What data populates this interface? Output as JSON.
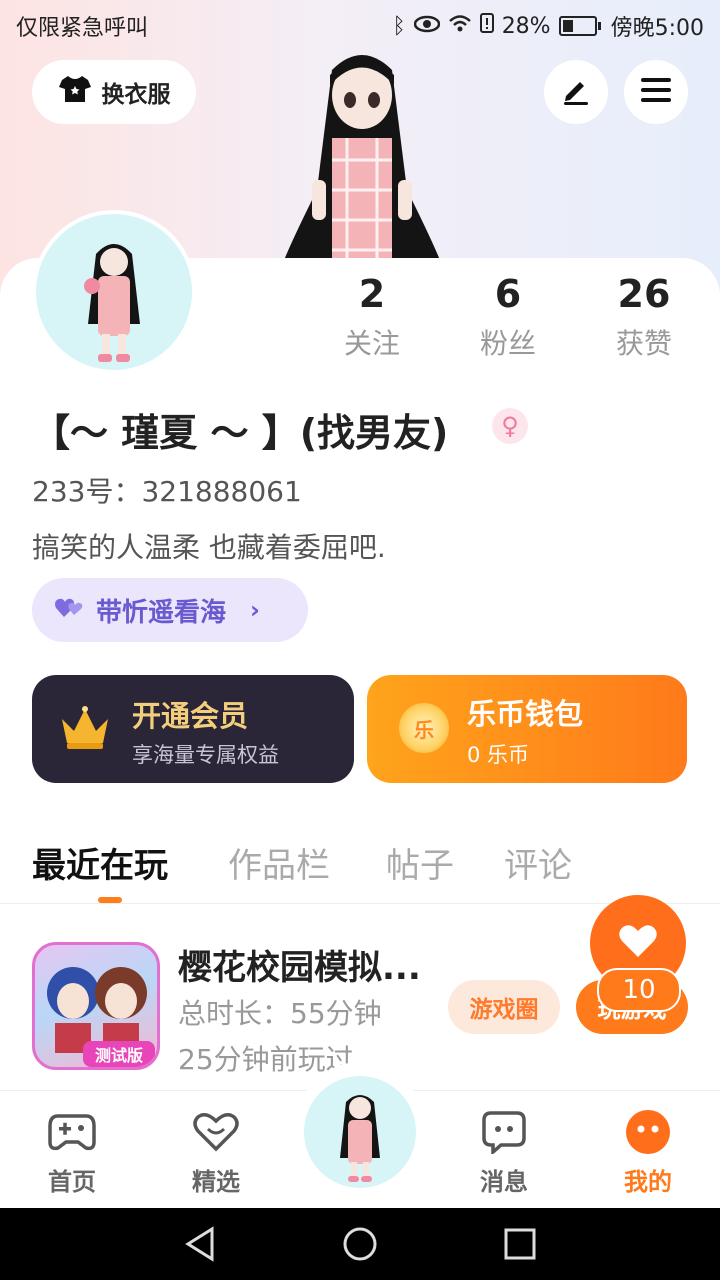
{
  "status_bar": {
    "left_text": "仅限紧急呼叫",
    "battery": "28%",
    "time": "傍晚5:00"
  },
  "header": {
    "outfit_label": "换衣服"
  },
  "profile": {
    "stats": [
      {
        "value": "2",
        "label": "关注"
      },
      {
        "value": "6",
        "label": "粉丝"
      },
      {
        "value": "26",
        "label": "获赞"
      }
    ],
    "username": "【～ 瑾夏 ～ 】(找男友)",
    "gender_symbol": "♀",
    "user_id": "233号：321888061",
    "bio": "搞笑的人温柔  也藏着委屈吧.",
    "couple_tag": "带忻遥看海"
  },
  "vip": {
    "title": "开通会员",
    "subtitle": "享海量专属权益"
  },
  "wallet": {
    "coin_char": "乐",
    "title": "乐币钱包",
    "subtitle": "0 乐币"
  },
  "tabs": [
    {
      "label": "最近在玩",
      "active": true
    },
    {
      "label": "作品栏"
    },
    {
      "label": "帖子"
    },
    {
      "label": "评论"
    }
  ],
  "recent_game": {
    "name": "樱花校园模拟...",
    "duration": "总时长：55分钟",
    "last_played": "25分钟前玩过",
    "icon_badge": "测试版",
    "circle_button": "游戏圈",
    "play_button": "玩游戏"
  },
  "float_like": {
    "count": "10"
  },
  "bottom_nav": {
    "items": [
      {
        "label": "首页",
        "icon": "gamepad-icon"
      },
      {
        "label": "精选",
        "icon": "heart-chat-icon"
      },
      {
        "label": "消息",
        "icon": "message-icon"
      },
      {
        "label": "我的",
        "icon": "mine-icon",
        "active": true
      }
    ]
  },
  "colors": {
    "accent": "#ff7a1b",
    "vip_bg": "#2a2638",
    "vip_gold": "#f3cf7d",
    "tag_purple": "#6a5ad0"
  }
}
